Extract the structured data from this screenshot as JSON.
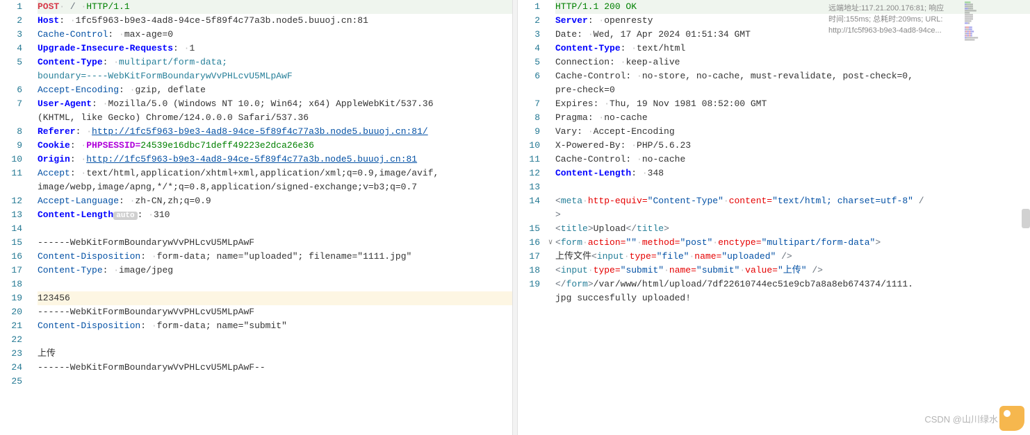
{
  "request": {
    "lines": [
      1,
      2,
      3,
      4,
      5,
      6,
      7,
      8,
      9,
      10,
      11,
      12,
      13,
      14,
      15,
      16,
      17,
      18,
      19,
      20,
      21,
      22,
      23,
      24,
      25
    ],
    "l1": {
      "method": "POST",
      "path": " / ",
      "proto": "HTTP/1.1"
    },
    "l2": {
      "k": "Host",
      "sep": ": ",
      "v": "1fc5f963-b9e3-4ad8-94ce-5f89f4c77a3b.node5.buuoj.cn:81"
    },
    "l3": {
      "k": "Cache-Control",
      "sep": ": ",
      "v": "max-age=0"
    },
    "l4": {
      "k": "Upgrade-Insecure-Requests",
      "sep": ": ",
      "v": "1"
    },
    "l5a": {
      "k": "Content-Type",
      "sep": ": ",
      "v": "multipart/form-data; "
    },
    "l5b": {
      "v": "boundary=----WebKitFormBoundarywVvPHLcvU5MLpAwF"
    },
    "l6": {
      "k": "Accept-Encoding",
      "sep": ": ",
      "v": "gzip, deflate"
    },
    "l7a": {
      "k": "User-Agent",
      "sep": ": ",
      "v": "Mozilla/5.0 (Windows NT 10.0; Win64; x64) AppleWebKit/537.36 "
    },
    "l7b": {
      "v": "(KHTML, like Gecko) Chrome/124.0.0.0 Safari/537.36"
    },
    "l8": {
      "k": "Referer",
      "sep": ": ",
      "v": "http://1fc5f963-b9e3-4ad8-94ce-5f89f4c77a3b.node5.buuoj.cn:81/"
    },
    "l9": {
      "k": "Cookie",
      "sep": ": ",
      "ck": "PHPSESSID",
      "eq": "=",
      "cv": "24539e16dbc71deff49223e2dca26e36"
    },
    "l10": {
      "k": "Origin",
      "sep": ": ",
      "v": "http://1fc5f963-b9e3-4ad8-94ce-5f89f4c77a3b.node5.buuoj.cn:81"
    },
    "l11a": {
      "k": "Accept",
      "sep": ": ",
      "v": "text/html,application/xhtml+xml,application/xml;q=0.9,image/avif,"
    },
    "l11b": {
      "v": "image/webp,image/apng,*/*;q=0.8,application/signed-exchange;v=b3;q=0.7"
    },
    "l12": {
      "k": "Accept-Language",
      "sep": ": ",
      "v": "zh-CN,zh;q=0.9"
    },
    "l13": {
      "k": "Content-Length",
      "badge": "auto",
      "sep": ": ",
      "v": "310"
    },
    "l15": "------WebKitFormBoundarywVvPHLcvU5MLpAwF",
    "l16": {
      "k": "Content-Disposition",
      "sep": ": ",
      "v": "form-data; name=\"uploaded\"; filename=\"1111.jpg\""
    },
    "l17": {
      "k": "Content-Type",
      "sep": ": ",
      "v": "image/jpeg"
    },
    "l19": "123456",
    "l20": "------WebKitFormBoundarywVvPHLcvU5MLpAwF",
    "l21": {
      "k": "Content-Disposition",
      "sep": ": ",
      "v": "form-data; name=\"submit\""
    },
    "l23": "上传",
    "l24": "------WebKitFormBoundarywVvPHLcvU5MLpAwF--"
  },
  "response": {
    "lines": [
      1,
      2,
      3,
      4,
      5,
      6,
      7,
      8,
      9,
      10,
      11,
      12,
      13,
      14,
      15,
      16,
      17,
      18,
      19
    ],
    "l1": "HTTP/1.1 200 OK",
    "l2": {
      "k": "Server",
      "sep": ": ",
      "v": "openresty"
    },
    "l3": {
      "k": "Date",
      "sep": ": ",
      "v": "Wed, 17 Apr 2024 01:51:34 GMT"
    },
    "l4": {
      "k": "Content-Type",
      "sep": ": ",
      "v": "text/html"
    },
    "l5": {
      "k": "Connection",
      "sep": ": ",
      "v": "keep-alive"
    },
    "l6a": {
      "k": "Cache-Control",
      "sep": ": ",
      "v": "no-store, no-cache, must-revalidate, post-check=0, "
    },
    "l6b": {
      "v": "pre-check=0"
    },
    "l7": {
      "k": "Expires",
      "sep": ": ",
      "v": "Thu, 19 Nov 1981 08:52:00 GMT"
    },
    "l8": {
      "k": "Pragma",
      "sep": ": ",
      "v": "no-cache"
    },
    "l9": {
      "k": "Vary",
      "sep": ": ",
      "v": "Accept-Encoding"
    },
    "l10": {
      "k": "X-Powered-By",
      "sep": ": ",
      "v": "PHP/5.6.23"
    },
    "l11": {
      "k": "Cache-Control",
      "sep": ": ",
      "v": "no-cache"
    },
    "l12": {
      "k": "Content-Length",
      "sep": ": ",
      "v": "348"
    },
    "l14": {
      "open": "<",
      "tag": "meta",
      "a1": "http-equiv=",
      "v1": "\"Content-Type\"",
      "a2": "content=",
      "v2": "\"text/html; charset=utf-8\"",
      "close": " /"
    },
    "l14b": ">",
    "l15": {
      "open": "<",
      "tag": "title",
      "close": ">",
      "text": "Upload",
      "open2": "</",
      "close2": ">"
    },
    "l16": {
      "open": "<",
      "tag": "form",
      "a1": "action=",
      "v1": "\"\"",
      "a2": "method=",
      "v2": "\"post\"",
      "a3": "enctype=",
      "v3": "\"multipart/form-data\"",
      "close": ">"
    },
    "l17": {
      "txt": "上传文件",
      "open": "<",
      "tag": "input",
      "a1": "type=",
      "v1": "\"file\"",
      "a2": "name=",
      "v2": "\"uploaded\"",
      "close": " />"
    },
    "l18": {
      "open": "<",
      "tag": "input",
      "a1": "type=",
      "v1": "\"submit\"",
      "a2": "name=",
      "v2": "\"submit\"",
      "a3": "value=",
      "v3": "\"上传\"",
      "close": " />"
    },
    "l19a": {
      "open": "</",
      "tag": "form",
      "close": ">",
      "txt": "/var/www/html/upload/7df22610744ec51e9cb7a8a8eb674374/1111."
    },
    "l19b": "jpg succesfully uploaded!"
  },
  "info": {
    "l1": "远端地址:117.21.200.176:81; 响应",
    "l2": "时间:155ms; 总耗时:209ms; URL:",
    "l3": "http://1fc5f963-b9e3-4ad8-94ce..."
  },
  "watermark": "CSDN @山川绿水"
}
